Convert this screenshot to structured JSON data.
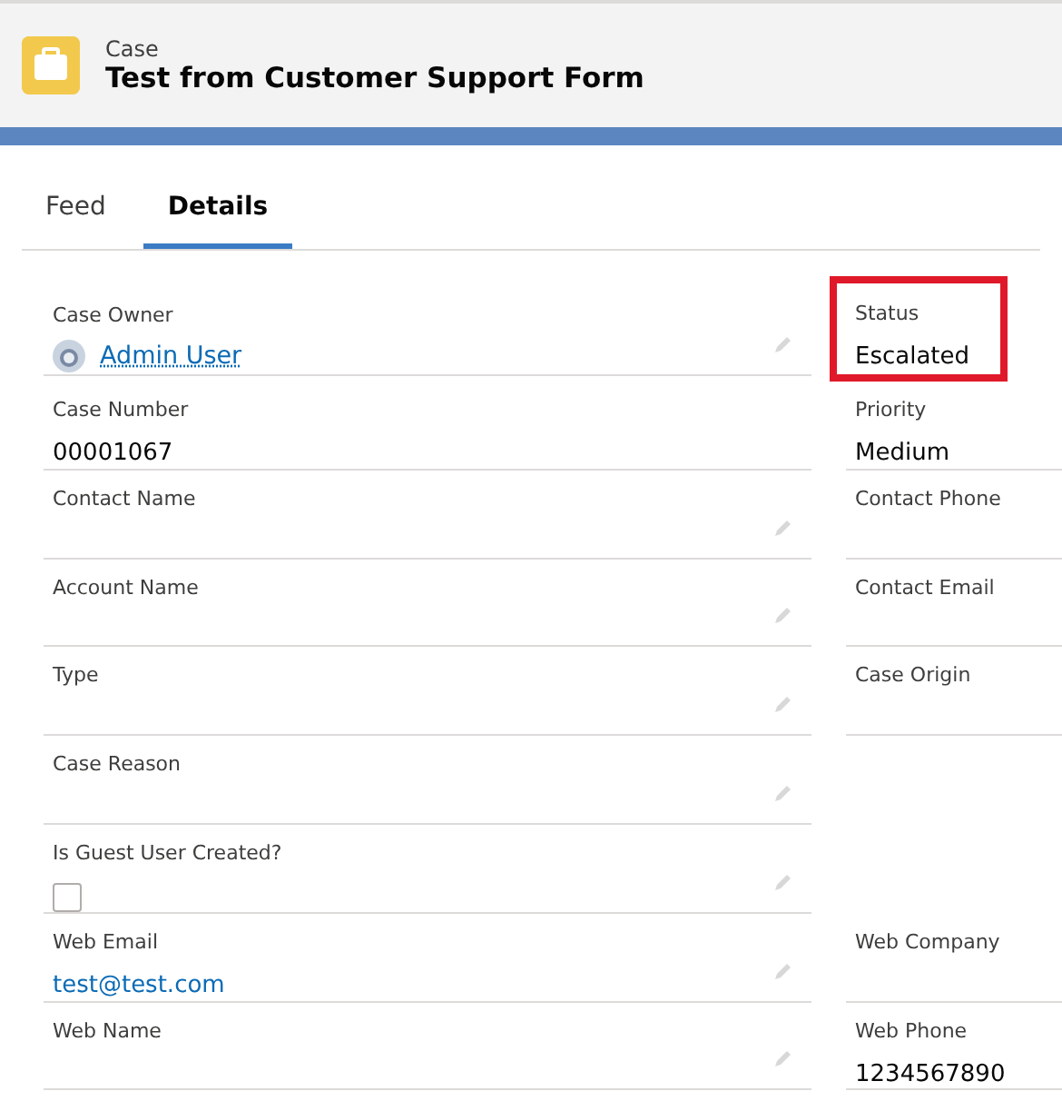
{
  "header": {
    "object_type": "Case",
    "title": "Test from Customer Support Form"
  },
  "tabs": [
    {
      "label": "Feed",
      "selected": false
    },
    {
      "label": "Details",
      "selected": true
    }
  ],
  "rows": [
    {
      "left": {
        "label": "Case Owner",
        "kind": "user",
        "value": "Admin User",
        "editable": true
      },
      "right": {
        "label": "Status",
        "kind": "text",
        "value": "Escalated",
        "highlighted": true
      }
    },
    {
      "left": {
        "label": "Case Number",
        "kind": "text",
        "value": "00001067",
        "editable": false
      },
      "right": {
        "label": "Priority",
        "kind": "text",
        "value": "Medium",
        "highlighted": false
      }
    },
    {
      "left": {
        "label": "Contact Name",
        "kind": "text",
        "editable": true
      },
      "right": {
        "label": "Contact Phone",
        "kind": "text",
        "highlighted": false
      }
    },
    {
      "left": {
        "label": "Account Name",
        "kind": "text",
        "editable": true
      },
      "right": {
        "label": "Contact Email",
        "kind": "text",
        "highlighted": false
      }
    },
    {
      "left": {
        "label": "Type",
        "kind": "text",
        "editable": true
      },
      "right": {
        "label": "Case Origin",
        "kind": "text",
        "highlighted": false
      }
    },
    {
      "left": {
        "label": "Case Reason",
        "kind": "text",
        "editable": true
      }
    },
    {
      "left": {
        "label": "Is Guest User Created?",
        "kind": "checkbox",
        "checked": false,
        "editable": true
      }
    },
    {
      "left": {
        "label": "Web Email",
        "kind": "link",
        "value": "test@test.com",
        "editable": true
      },
      "right": {
        "label": "Web Company",
        "kind": "text",
        "highlighted": false
      }
    },
    {
      "left": {
        "label": "Web Name",
        "kind": "text",
        "editable": true
      },
      "right": {
        "label": "Web Phone",
        "kind": "text",
        "value": "1234567890",
        "highlighted": false
      }
    }
  ]
}
